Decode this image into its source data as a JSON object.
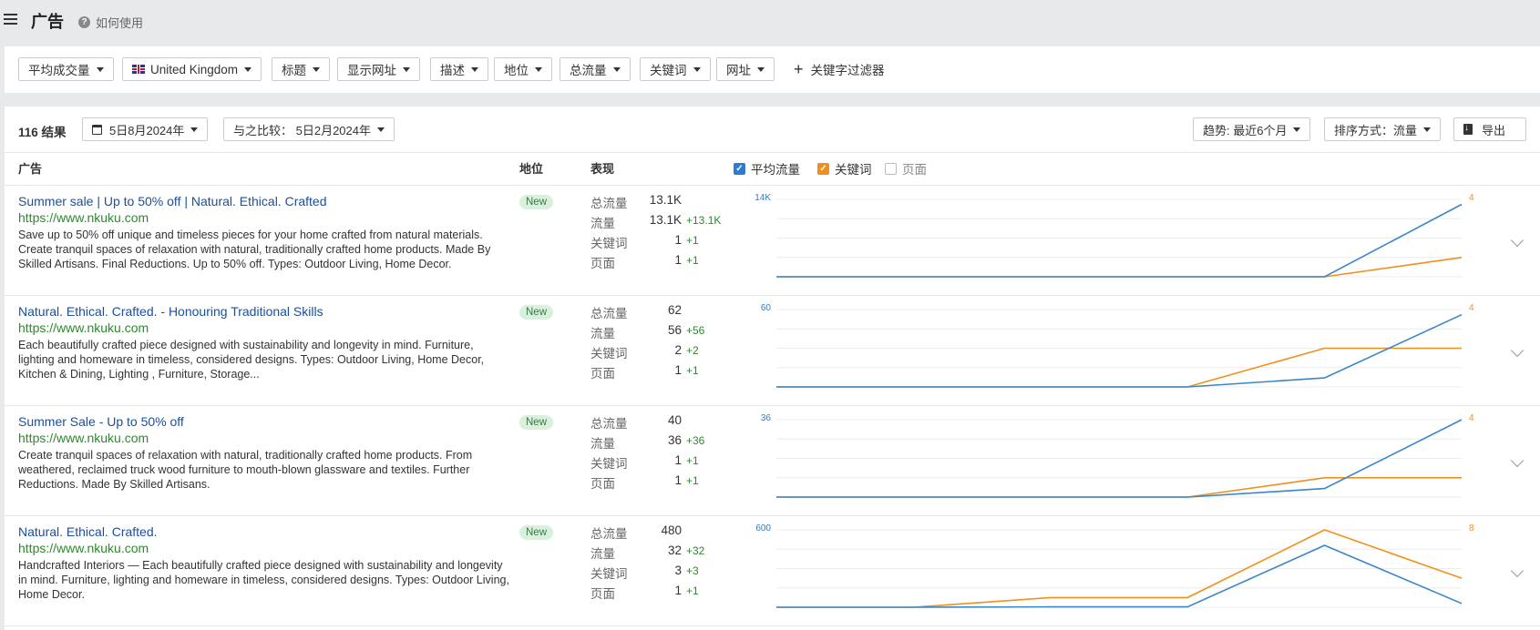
{
  "header": {
    "title": "广告",
    "help": "如何使用"
  },
  "filters": [
    {
      "label": "平均成交量"
    },
    {
      "label": "United Kingdom",
      "flag": "uk-flag"
    },
    {
      "label": "标题"
    },
    {
      "label": "显示网址"
    },
    {
      "label": "描述"
    },
    {
      "label": "地位"
    },
    {
      "label": "总流量"
    },
    {
      "label": "关键词"
    },
    {
      "label": "网址"
    }
  ],
  "add_filter": "关键字过滤器",
  "toolbar": {
    "results": "116 结果",
    "date": "5日8月2024年",
    "compare": "与之比较： 5日2月2024年",
    "trend": "趋势: 最近6个月",
    "sort": "排序方式：流量",
    "export": "导出"
  },
  "columns": {
    "ad": "广告",
    "position": "地位",
    "performance": "表现"
  },
  "legend": [
    {
      "label": "平均流量",
      "checked": true,
      "color": "#2c7cd4"
    },
    {
      "label": "关键词",
      "checked": true,
      "color": "#f0901a"
    },
    {
      "label": "页面",
      "checked": false
    }
  ],
  "metric_labels": [
    "总流量",
    "流量",
    "关键词",
    "页面"
  ],
  "ads": [
    {
      "title": "Summer sale | Up to 50% off | Natural. Ethical. Crafted",
      "url": "https://www.nkuku.com",
      "desc": "Save up to 50% off unique and timeless pieces for your home crafted from natural materials. Create tranquil spaces of relaxation with natural, traditionally crafted home products. Made By Skilled Artisans. Final Reductions. Up to 50% off. Types: Outdoor Living, Home Decor.",
      "badge": "New",
      "metrics": [
        {
          "value": "13.1K",
          "delta": ""
        },
        {
          "value": "13.1K",
          "delta": "+13.1K"
        },
        {
          "value": "1",
          "delta": "+1"
        },
        {
          "value": "1",
          "delta": "+1"
        }
      ],
      "chart": {
        "left_max_label": "14K",
        "right_max_label": "4",
        "left_max": 14000,
        "right_max": 4,
        "blue": [
          0,
          0,
          0,
          0,
          0,
          13100
        ],
        "orange": [
          0,
          0,
          0,
          0,
          0,
          1
        ]
      }
    },
    {
      "title": "Natural. Ethical. Crafted. - Honouring Traditional Skills",
      "url": "https://www.nkuku.com",
      "desc": "Each beautifully crafted piece designed with sustainability and longevity in mind. Furniture, lighting and homeware in timeless, considered designs. Types: Outdoor Living, Home Decor, Kitchen & Dining, Lighting , Furniture, Storage...",
      "badge": "New",
      "metrics": [
        {
          "value": "62",
          "delta": ""
        },
        {
          "value": "56",
          "delta": "+56"
        },
        {
          "value": "2",
          "delta": "+2"
        },
        {
          "value": "1",
          "delta": "+1"
        }
      ],
      "chart": {
        "left_max_label": "60",
        "right_max_label": "4",
        "left_max": 60,
        "right_max": 4,
        "blue": [
          0,
          0,
          0,
          0,
          7,
          56
        ],
        "orange": [
          0,
          0,
          0,
          0,
          2,
          2
        ]
      }
    },
    {
      "title": "Summer Sale - Up to 50% off",
      "url": "https://www.nkuku.com",
      "desc": "Create tranquil spaces of relaxation with natural, traditionally crafted home products. From weathered, reclaimed truck wood furniture to mouth-blown glassware and textiles. Further Reductions. Made By Skilled Artisans.",
      "badge": "New",
      "metrics": [
        {
          "value": "40",
          "delta": ""
        },
        {
          "value": "36",
          "delta": "+36"
        },
        {
          "value": "1",
          "delta": "+1"
        },
        {
          "value": "1",
          "delta": "+1"
        }
      ],
      "chart": {
        "left_max_label": "36",
        "right_max_label": "4",
        "left_max": 36,
        "right_max": 4,
        "blue": [
          0,
          0,
          0,
          0,
          4,
          36
        ],
        "orange": [
          0,
          0,
          0,
          0,
          1,
          1
        ]
      }
    },
    {
      "title": "Natural. Ethical. Crafted.",
      "url": "https://www.nkuku.com",
      "desc": "Handcrafted Interiors — Each beautifully crafted piece designed with sustainability and longevity in mind. Furniture, lighting and homeware in timeless, considered designs. Types: Outdoor Living, Home Decor.",
      "badge": "New",
      "metrics": [
        {
          "value": "480",
          "delta": ""
        },
        {
          "value": "32",
          "delta": "+32"
        },
        {
          "value": "3",
          "delta": "+3"
        },
        {
          "value": "1",
          "delta": "+1"
        }
      ],
      "chart": {
        "left_max_label": "600",
        "right_max_label": "8",
        "left_max": 600,
        "right_max": 8,
        "blue": [
          0,
          0,
          3,
          3,
          480,
          30
        ],
        "orange": [
          0,
          0,
          1,
          1,
          8,
          3
        ]
      }
    }
  ]
}
